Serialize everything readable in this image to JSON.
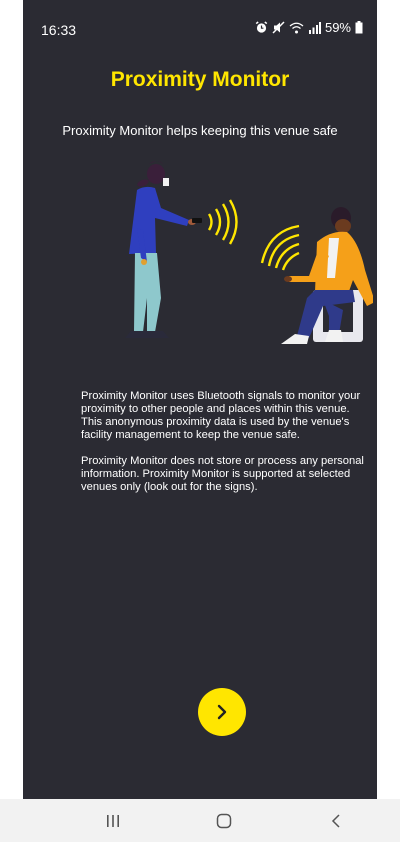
{
  "status_bar": {
    "time": "16:33",
    "battery": "59%",
    "icons": [
      "alarm-icon",
      "mute-icon",
      "wifi-icon",
      "signal-icon",
      "battery-icon"
    ]
  },
  "screen": {
    "title": "Proximity Monitor",
    "subtitle": "Proximity Monitor helps keeping this venue safe",
    "paragraph_1": "Proximity Monitor uses Bluetooth signals to monitor your proximity to other people and places within this venue. This anonymous proximity data is used by the venue's facility management to keep the venue safe.",
    "paragraph_2": "Proximity Monitor does not store or process any personal information. Proximity Monitor is supported at selected venues only (look out for the signs).",
    "next_icon": "chevron-right-icon"
  },
  "nav_bar": {
    "buttons": [
      "recent-apps-icon",
      "home-icon",
      "back-icon"
    ]
  },
  "colors": {
    "background": "#2b2b33",
    "accent": "#ffe600",
    "text": "#ffffff",
    "nav_background": "#f2f2f2"
  }
}
